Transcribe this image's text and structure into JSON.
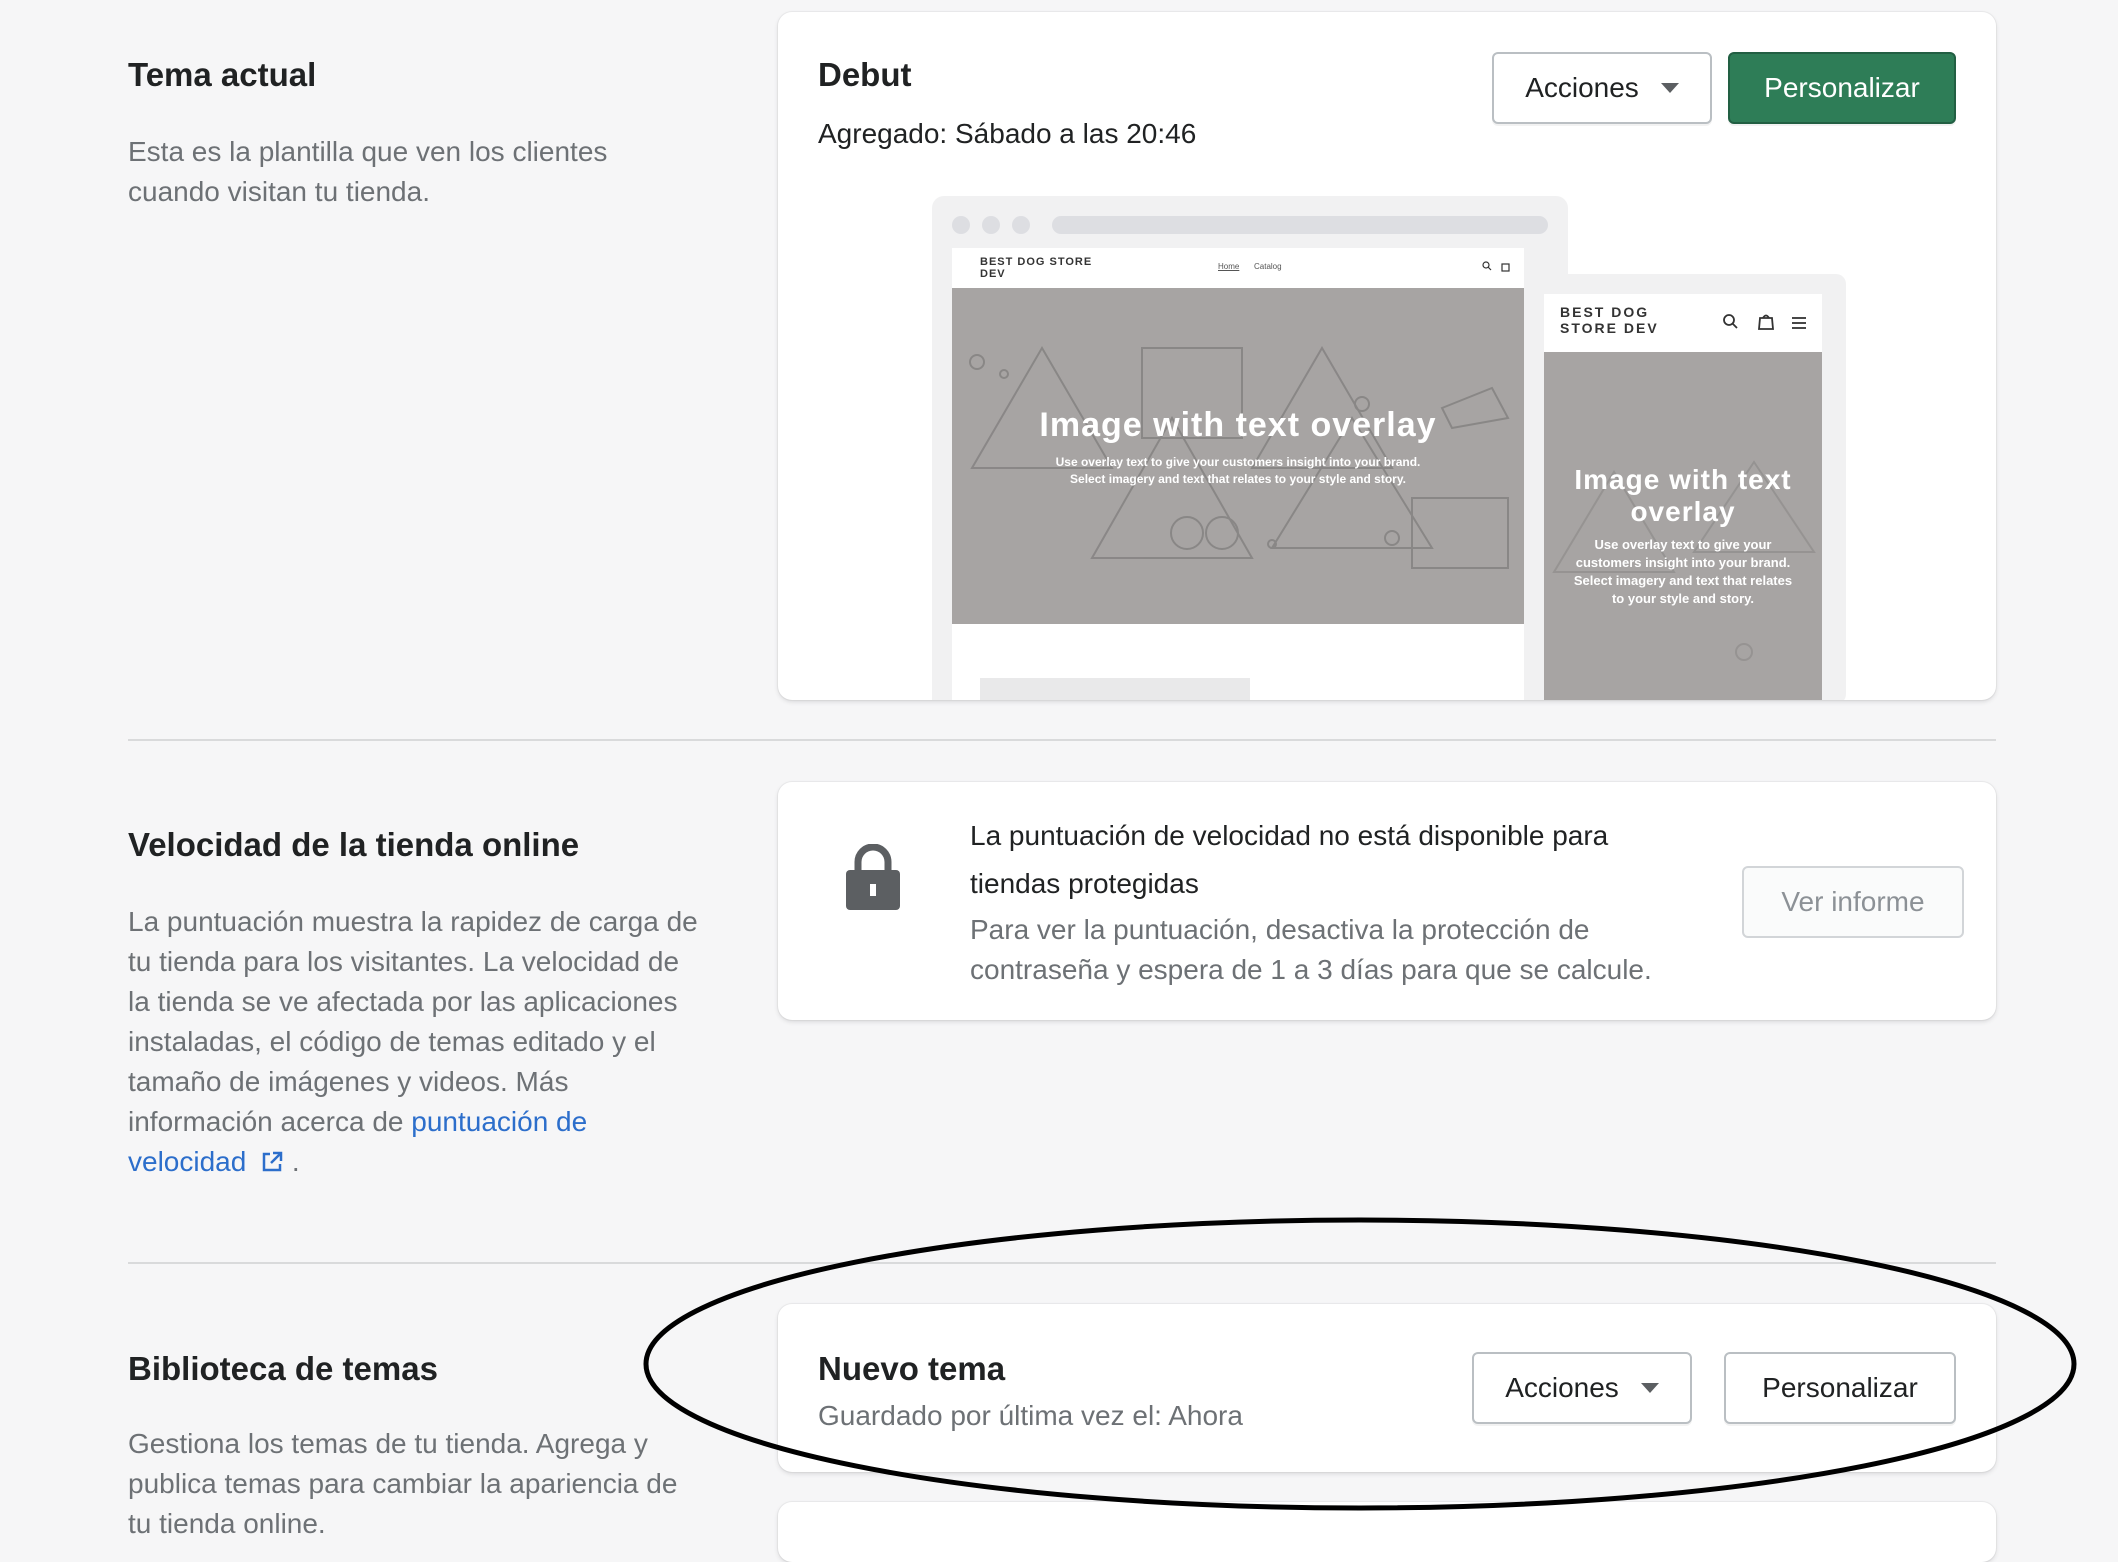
{
  "current_theme": {
    "section_title": "Tema actual",
    "section_desc": "Esta es la plantilla que ven los clientes cuando visitan tu tienda.",
    "theme_name": "Debut",
    "added": "Agregado: Sábado a las 20:46",
    "actions_label": "Acciones",
    "customize_label": "Personalizar",
    "preview": {
      "store_name": "BEST DOG STORE DEV",
      "nav_home": "Home",
      "nav_catalog": "Catalog",
      "desktop_overlay_title": "Image with text overlay",
      "desktop_overlay_text": "Use overlay text to give your customers insight into your brand. Select imagery and text that relates to your style and story.",
      "mobile_store_name": "BEST DOG STORE DEV",
      "mobile_overlay_title": "Image with text overlay",
      "mobile_overlay_text": "Use overlay text to give your customers insight into your brand. Select imagery and text that relates to your style and story."
    }
  },
  "speed": {
    "section_title": "Velocidad de la tienda online",
    "section_desc": "La puntuación muestra la rapidez de carga de tu tienda para los visitantes. La velocidad de la tienda se ve afectada por las aplicaciones instaladas, el código de temas editado y el tamaño de imágenes y videos. Más información acerca de",
    "link_text": "puntuación de velocidad",
    "period": ".",
    "card_title": "La puntuación de velocidad no está disponible para tiendas protegidas",
    "card_text": "Para ver la puntuación, desactiva la protección de contraseña y espera de 1 a 3 días para que se calcule.",
    "report_label": "Ver informe"
  },
  "library": {
    "section_title": "Biblioteca de temas",
    "section_desc": "Gestiona los temas de tu tienda. Agrega y publica temas para cambiar la apariencia de tu tienda online.",
    "theme_name": "Nuevo tema",
    "saved": "Guardado por última vez el: Ahora",
    "actions_label": "Acciones",
    "customize_label": "Personalizar"
  },
  "colors": {
    "primary": "#2e7d57",
    "link": "#2c6ecb",
    "annotation": "#000000"
  }
}
